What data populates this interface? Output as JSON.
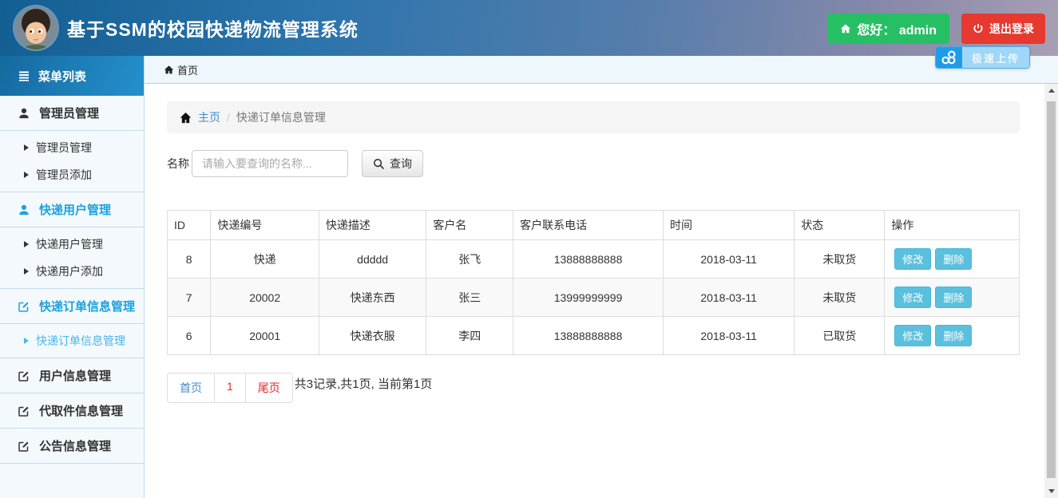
{
  "header": {
    "title": "基于SSM的校园快递物流管理系统",
    "greeting": "您好： admin",
    "logout": "退出登录"
  },
  "floating_widget": {
    "label": "极速上传"
  },
  "topbar": {
    "home": "首页"
  },
  "sidebar": {
    "header": "菜单列表",
    "sections": [
      {
        "title": "管理员管理",
        "children": [
          "管理员管理",
          "管理员添加"
        ]
      },
      {
        "title": "快递用户管理",
        "children": [
          "快递用户管理",
          "快递用户添加"
        ]
      },
      {
        "title": "快递订单信息管理",
        "children": [
          "快递订单信息管理"
        ]
      },
      {
        "title": "用户信息管理",
        "children": []
      },
      {
        "title": "代取件信息管理",
        "children": []
      },
      {
        "title": "公告信息管理",
        "children": []
      }
    ]
  },
  "breadcrumb": {
    "home": "主页",
    "separator": "/",
    "current": "快递订单信息管理"
  },
  "search": {
    "label": "名称",
    "placeholder": "请输入要查询的名称...",
    "button": "查询"
  },
  "table": {
    "columns": [
      "ID",
      "快递编号",
      "快递描述",
      "客户名",
      "客户联系电话",
      "时间",
      "状态",
      "操作"
    ],
    "rows": [
      {
        "id": "8",
        "code": "快递",
        "desc": "ddddd",
        "customer": "张飞",
        "phone": "13888888888",
        "time": "2018-03-11",
        "status": "未取货"
      },
      {
        "id": "7",
        "code": "20002",
        "desc": "快递东西",
        "customer": "张三",
        "phone": "13999999999",
        "time": "2018-03-11",
        "status": "未取货"
      },
      {
        "id": "6",
        "code": "20001",
        "desc": "快递衣服",
        "customer": "李四",
        "phone": "13888888888",
        "time": "2018-03-11",
        "status": "已取货"
      }
    ],
    "edit_label": "修改",
    "delete_label": "删除"
  },
  "pagination": {
    "first": "首页",
    "page": "1",
    "last": "尾页",
    "summary": "共3记录,共1页, 当前第1页"
  },
  "colors": {
    "accent_blue": "#1da1dd",
    "info_button": "#5bc0de",
    "greeting_green": "#26bf64",
    "logout_red": "#e6392f",
    "header_gradient_start": "#135e93",
    "header_gradient_end": "#a89fb4"
  }
}
